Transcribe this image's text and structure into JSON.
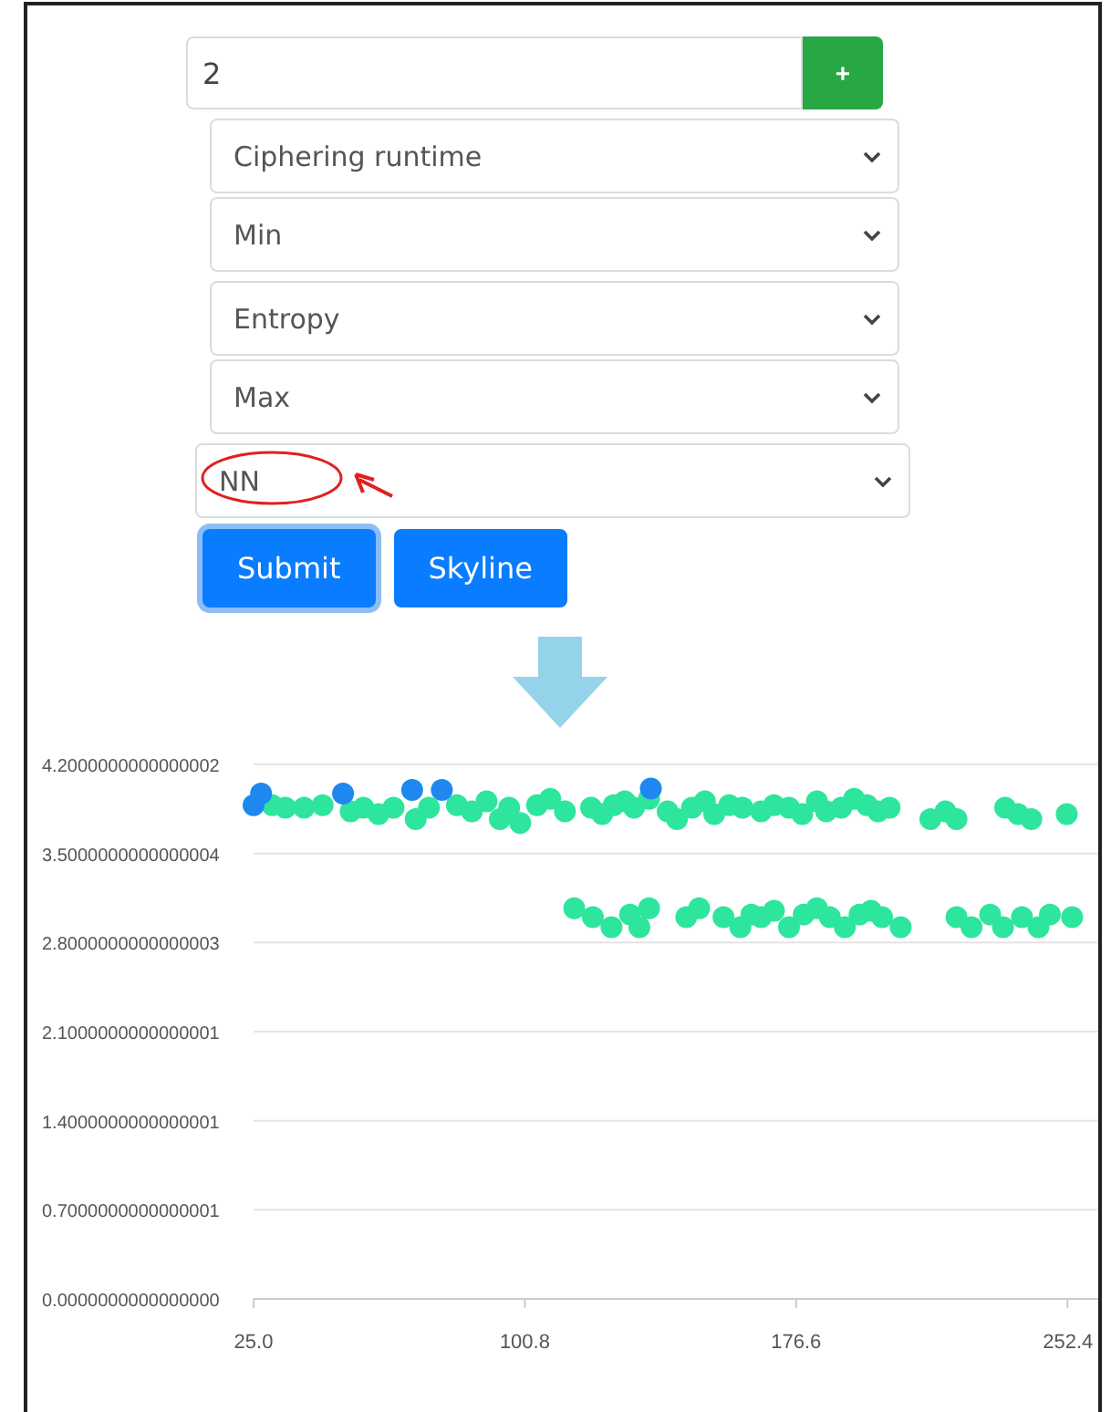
{
  "count_input": {
    "value": "2"
  },
  "add_button": {
    "label": "+"
  },
  "selects": [
    {
      "value": "Ciphering runtime",
      "kind": "small"
    },
    {
      "value": "Min",
      "kind": "small"
    },
    {
      "value": "Entropy",
      "kind": "small"
    },
    {
      "value": "Max",
      "kind": "small"
    },
    {
      "value": "NN",
      "kind": "wide",
      "highlighted": true
    }
  ],
  "buttons": [
    {
      "label": "Submit",
      "focused": true
    },
    {
      "label": "Skyline",
      "focused": false
    }
  ],
  "chart_data": {
    "type": "scatter",
    "grid": true,
    "xlim": [
      25,
      261
    ],
    "ylim": [
      0,
      4.2
    ],
    "xticks": [
      {
        "value": 25,
        "label": "25.0"
      },
      {
        "value": 100.8,
        "label": "100.8"
      },
      {
        "value": 176.6,
        "label": "176.6"
      },
      {
        "value": 252.4,
        "label": "252.4"
      }
    ],
    "yticks": [
      {
        "value": 4.2,
        "label": "4.2000000000000002"
      },
      {
        "value": 3.5,
        "label": "3.5000000000000004"
      },
      {
        "value": 2.8,
        "label": "2.8000000000000003"
      },
      {
        "value": 2.1,
        "label": "2.1000000000000001"
      },
      {
        "value": 1.4,
        "label": "1.4000000000000001"
      },
      {
        "value": 0.7,
        "label": "0.7000000000000001"
      },
      {
        "value": 0,
        "label": "0.0000000000000000"
      }
    ],
    "series": [
      {
        "color": "#2ee59d",
        "x": [
          30.2,
          33.9,
          39.1,
          44.3,
          52.1,
          55.7,
          59.9,
          64.1,
          70.3,
          74.0,
          81.8,
          86.0,
          90.1,
          93.8,
          96.4,
          99.5,
          104.2,
          107.9,
          112.0,
          119.3,
          122.4,
          125.6,
          128.7,
          131.3,
          135.5,
          140.7,
          143.3,
          147.5,
          151.1,
          153.7,
          157.9,
          161.6,
          166.8,
          170.4,
          174.6,
          178.3,
          182.4,
          185.0,
          189.2,
          192.8,
          196.4,
          199.5,
          202.7,
          214.1,
          218.3,
          221.4,
          235.0,
          238.6,
          242.3,
          252.2,
          114.6,
          119.8,
          125.0,
          130.2,
          132.8,
          135.5,
          145.9,
          149.5,
          156.3,
          161.0,
          164.1,
          166.8,
          170.4,
          174.6,
          178.7,
          182.4,
          186.0,
          190.2,
          194.3,
          197.5,
          200.6,
          205.8,
          221.4,
          225.6,
          230.8,
          234.4,
          239.7,
          244.3,
          247.5,
          253.7
        ],
        "values": [
          3.88,
          3.86,
          3.86,
          3.88,
          3.83,
          3.86,
          3.81,
          3.86,
          3.77,
          3.86,
          3.88,
          3.83,
          3.91,
          3.77,
          3.86,
          3.74,
          3.88,
          3.93,
          3.83,
          3.86,
          3.81,
          3.88,
          3.91,
          3.86,
          3.93,
          3.83,
          3.77,
          3.86,
          3.91,
          3.81,
          3.88,
          3.86,
          3.83,
          3.88,
          3.86,
          3.81,
          3.91,
          3.83,
          3.86,
          3.93,
          3.88,
          3.83,
          3.86,
          3.77,
          3.83,
          3.77,
          3.86,
          3.81,
          3.77,
          3.81,
          3.07,
          3.0,
          2.92,
          3.02,
          2.92,
          3.07,
          3.0,
          3.07,
          3.0,
          2.92,
          3.02,
          3.0,
          3.05,
          2.92,
          3.02,
          3.07,
          3.0,
          2.92,
          3.02,
          3.05,
          3.0,
          2.92,
          3.0,
          2.92,
          3.02,
          2.92,
          3.0,
          2.92,
          3.02,
          3.0
        ]
      },
      {
        "color": "#1e88f0",
        "x": [
          25.0,
          27.1,
          50.0,
          69.3,
          77.6,
          136.0
        ],
        "values": [
          3.88,
          3.97,
          3.97,
          4.0,
          4.0,
          4.01
        ]
      }
    ]
  }
}
